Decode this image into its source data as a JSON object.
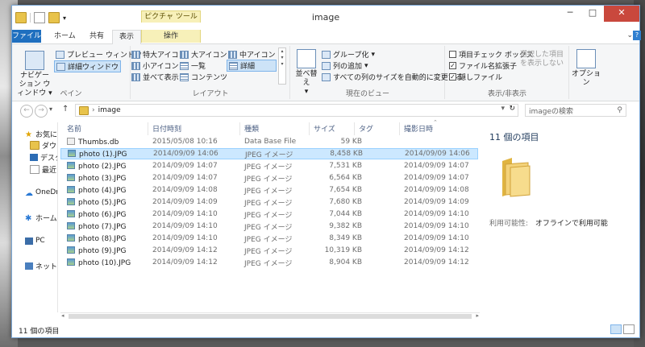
{
  "window": {
    "title": "image"
  },
  "ribbon_tabs": {
    "file": "ファイル",
    "home": "ホーム",
    "share": "共有",
    "view": "表示",
    "manage": "操作",
    "context_group": "ピクチャ ツール"
  },
  "ribbon": {
    "pane": {
      "navigation_pane": "ナビゲーション ウィンドウ",
      "preview_pane": "プレビュー ウィンドウ",
      "details_pane": "詳細ウィンドウ",
      "label": "ペイン"
    },
    "layout": {
      "items": [
        "特大アイコン",
        "大アイコン",
        "中アイコン",
        "小アイコン",
        "一覧",
        "詳細",
        "並べて表示",
        "コンテンツ"
      ],
      "label": "レイアウト"
    },
    "current_view": {
      "sort": "並べ替え",
      "group_by": "グループ化",
      "add_columns": "列の追加",
      "fit_columns": "すべての列のサイズを自動的に変更する",
      "label": "現在のビュー"
    },
    "show_hide": {
      "item_checkboxes": "項目チェック ボックス",
      "file_extensions": "ファイル名拡張子",
      "hidden_items": "隠しファイル",
      "hide_selected": "選択した項目を表示しない",
      "options": "オプション",
      "label": "表示/非表示"
    }
  },
  "address": {
    "path": "image",
    "search_placeholder": "imageの検索"
  },
  "nav": {
    "favorites": "お気に入り",
    "downloads": "ダウン",
    "desktop": "デスク",
    "recent": "最近",
    "onedrive": "OneDr",
    "homegroup": "ホーム",
    "pc": "PC",
    "network": "ネットワ"
  },
  "columns": {
    "name": "名前",
    "date": "日付時刻",
    "type": "種類",
    "size": "サイズ",
    "tag": "タグ",
    "taken": "撮影日時"
  },
  "files": [
    {
      "name": "Thumbs.db",
      "date": "2015/05/08 10:16",
      "type": "Data Base File",
      "size": "59 KB",
      "taken": "",
      "icon": "db-file-icon",
      "selected": false
    },
    {
      "name": "photo (1).JPG",
      "date": "2014/09/09 14:06",
      "type": "JPEG イメージ",
      "size": "8,458 KB",
      "taken": "2014/09/09 14:06",
      "icon": "image-file-icon",
      "selected": true
    },
    {
      "name": "photo (2).JPG",
      "date": "2014/09/09 14:07",
      "type": "JPEG イメージ",
      "size": "7,531 KB",
      "taken": "2014/09/09 14:07",
      "icon": "image-file-icon",
      "selected": false
    },
    {
      "name": "photo (3).JPG",
      "date": "2014/09/09 14:07",
      "type": "JPEG イメージ",
      "size": "6,564 KB",
      "taken": "2014/09/09 14:07",
      "icon": "image-file-icon",
      "selected": false
    },
    {
      "name": "photo (4).JPG",
      "date": "2014/09/09 14:08",
      "type": "JPEG イメージ",
      "size": "7,654 KB",
      "taken": "2014/09/09 14:08",
      "icon": "image-file-icon",
      "selected": false
    },
    {
      "name": "photo (5).JPG",
      "date": "2014/09/09 14:09",
      "type": "JPEG イメージ",
      "size": "7,680 KB",
      "taken": "2014/09/09 14:09",
      "icon": "image-file-icon",
      "selected": false
    },
    {
      "name": "photo (6).JPG",
      "date": "2014/09/09 14:10",
      "type": "JPEG イメージ",
      "size": "7,044 KB",
      "taken": "2014/09/09 14:10",
      "icon": "image-file-icon",
      "selected": false
    },
    {
      "name": "photo (7).JPG",
      "date": "2014/09/09 14:10",
      "type": "JPEG イメージ",
      "size": "9,382 KB",
      "taken": "2014/09/09 14:10",
      "icon": "image-file-icon",
      "selected": false
    },
    {
      "name": "photo (8).JPG",
      "date": "2014/09/09 14:10",
      "type": "JPEG イメージ",
      "size": "8,349 KB",
      "taken": "2014/09/09 14:10",
      "icon": "image-file-icon",
      "selected": false
    },
    {
      "name": "photo (9).JPG",
      "date": "2014/09/09 14:12",
      "type": "JPEG イメージ",
      "size": "10,319 KB",
      "taken": "2014/09/09 14:12",
      "icon": "image-file-icon",
      "selected": false
    },
    {
      "name": "photo (10).JPG",
      "date": "2014/09/09 14:12",
      "type": "JPEG イメージ",
      "size": "8,904 KB",
      "taken": "2014/09/09 14:12",
      "icon": "image-file-icon",
      "selected": false
    }
  ],
  "details": {
    "count": "11 個の項目",
    "availability_label": "利用可能性:",
    "availability_value": "オフラインで利用可能"
  },
  "status": {
    "count": "11 個の項目"
  },
  "colors": {
    "selection": "#cce8ff",
    "accent": "#1f6fbf",
    "close": "#c9483d"
  }
}
